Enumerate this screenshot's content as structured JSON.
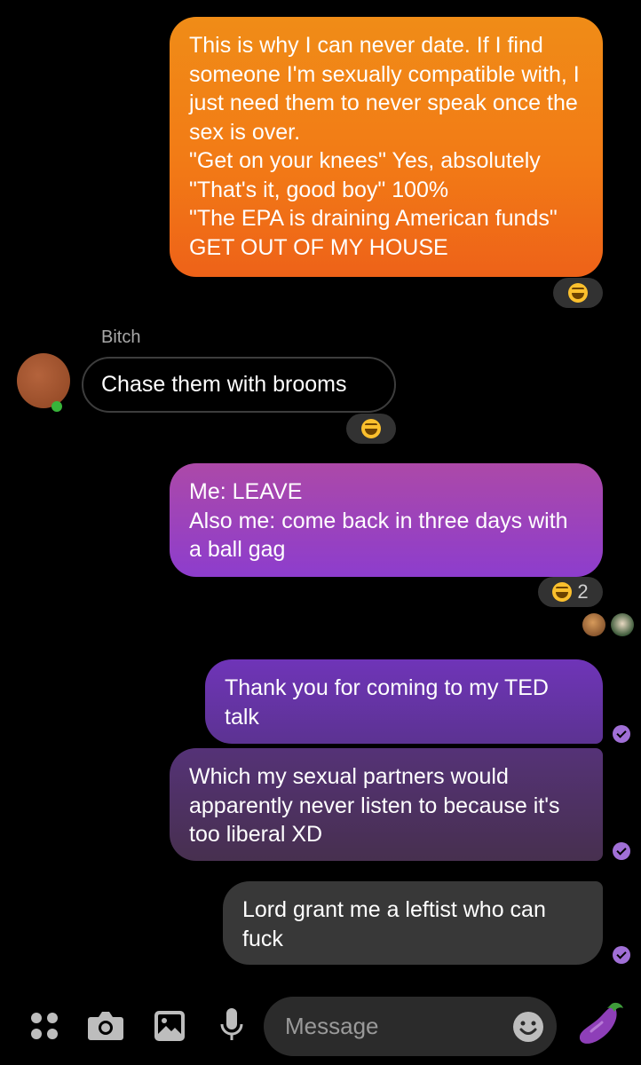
{
  "conversation": {
    "messages": [
      {
        "sender": "me",
        "text": "This is why I can never date. If I find someone I'm sexually compatible with, I just need them to never speak once the sex is over.\n\"Get on your knees\" Yes, absolutely\n\"That's it, good boy\" 100%\n\"The EPA is draining American funds\" GET OUT OF MY HOUSE",
        "reaction": {
          "emoji": "grinning-squinting-face"
        }
      },
      {
        "sender": "other",
        "sender_name": "Bitch",
        "text": "Chase them with brooms",
        "reaction": {
          "emoji": "grinning-squinting-face"
        }
      },
      {
        "sender": "me",
        "text": "Me: LEAVE\nAlso me: come back in three days with a ball gag",
        "reaction": {
          "emoji": "grinning-squinting-face",
          "count": "2"
        }
      },
      {
        "sender": "me",
        "text": "Thank you for coming to my TED talk"
      },
      {
        "sender": "me",
        "text": "Which my sexual partners would apparently never listen to because it's too liberal XD"
      },
      {
        "sender": "me",
        "text": "Lord grant me a leftist who can fuck"
      }
    ]
  },
  "composer": {
    "placeholder": "Message",
    "icons": [
      "apps-icon",
      "camera-icon",
      "gallery-icon",
      "microphone-icon",
      "emoji-icon",
      "eggplant-icon"
    ]
  },
  "colors": {
    "accent": "#8d3dcd",
    "bubble_orange": "#f27b16",
    "check": "#a06fd6"
  }
}
